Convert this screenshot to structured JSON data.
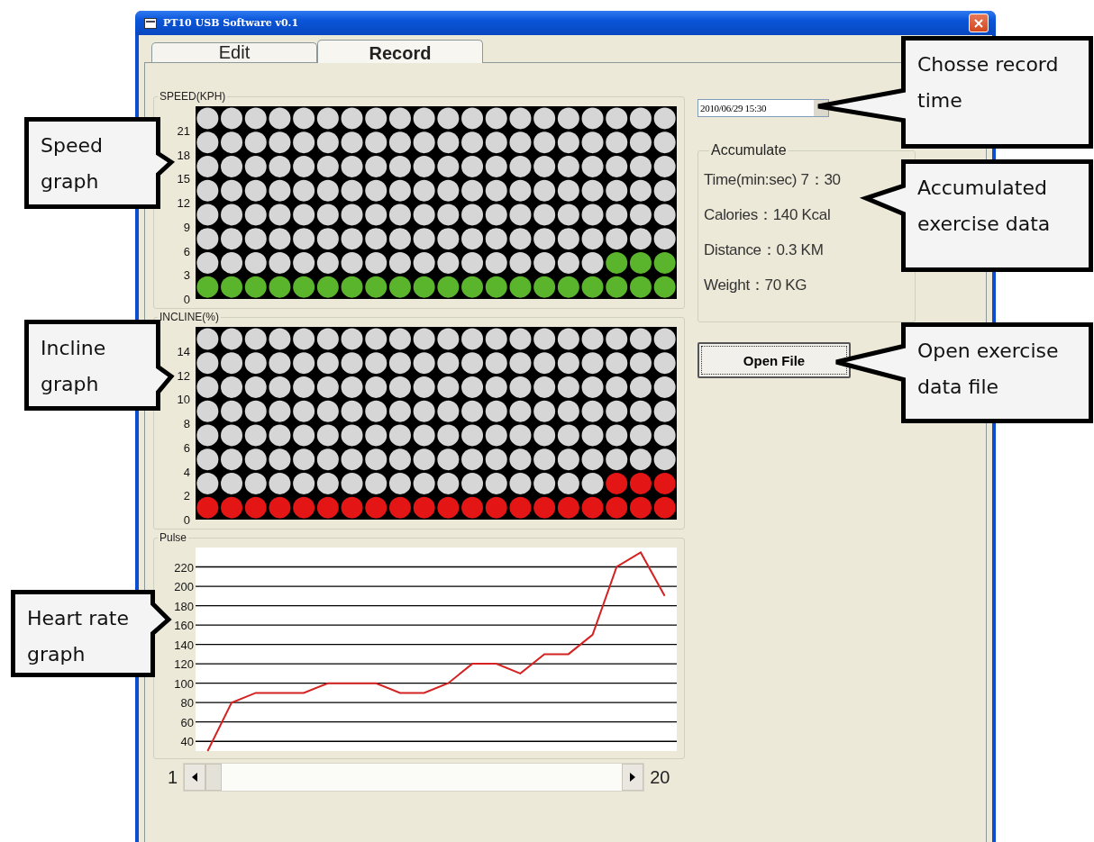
{
  "window": {
    "title": "PT10 USB Software v0.1"
  },
  "tabs": [
    {
      "label": "Edit",
      "selected": false
    },
    {
      "label": "Record",
      "selected": true
    }
  ],
  "speed_panel": {
    "title": "SPEED(KPH)",
    "color": "#5bb52c",
    "axis_labels": [
      "21",
      "18",
      "15",
      "12",
      "9",
      "6",
      "3",
      "0"
    ],
    "columns": [
      {
        "level": 0.125
      },
      {
        "level": 0.125
      },
      {
        "level": 0.125
      },
      {
        "level": 0.125
      },
      {
        "level": 0.125
      },
      {
        "level": 0.125
      },
      {
        "level": 0.125
      },
      {
        "level": 0.125
      },
      {
        "level": 0.125
      },
      {
        "level": 0.125
      },
      {
        "level": 0.125
      },
      {
        "level": 0.125
      },
      {
        "level": 0.125
      },
      {
        "level": 0.125
      },
      {
        "level": 0.125
      },
      {
        "level": 0.125
      },
      {
        "level": 0.125
      },
      {
        "level": 0.25
      },
      {
        "level": 0.25
      },
      {
        "level": 0.25
      }
    ]
  },
  "incline_panel": {
    "title": "INCLINE(%)",
    "color": "#e31515",
    "axis_labels": [
      "14",
      "12",
      "10",
      "8",
      "6",
      "4",
      "2",
      "0"
    ],
    "columns": [
      {
        "level": 0.125
      },
      {
        "level": 0.125
      },
      {
        "level": 0.125
      },
      {
        "level": 0.125
      },
      {
        "level": 0.125
      },
      {
        "level": 0.125
      },
      {
        "level": 0.125
      },
      {
        "level": 0.125
      },
      {
        "level": 0.125
      },
      {
        "level": 0.125
      },
      {
        "level": 0.125
      },
      {
        "level": 0.125
      },
      {
        "level": 0.125
      },
      {
        "level": 0.125
      },
      {
        "level": 0.125
      },
      {
        "level": 0.125
      },
      {
        "level": 0.125
      },
      {
        "level": 0.25
      },
      {
        "level": 0.25
      },
      {
        "level": 0.25
      }
    ]
  },
  "pulse_panel": {
    "title": "Pulse",
    "chart_data": {
      "type": "line",
      "grid": true,
      "ylim": [
        30,
        240
      ],
      "yticks": [
        40,
        60,
        80,
        100,
        120,
        140,
        160,
        180,
        200,
        220
      ],
      "series": [
        {
          "color": "#d42222",
          "values": [
            30,
            80,
            90,
            90,
            90,
            100,
            100,
            100,
            90,
            90,
            100,
            120,
            120,
            110,
            130,
            130,
            150,
            220,
            235,
            190
          ]
        }
      ]
    }
  },
  "scrollbar": {
    "min_label": "1",
    "max_label": "20"
  },
  "record_time": {
    "value": "2010/06/29 15:30"
  },
  "accumulate": {
    "title": "Accumulate",
    "lines": [
      "Time(min:sec) 7：30",
      "Calories：140 Kcal",
      "Distance：0.3 KM",
      "Weight：70 KG"
    ]
  },
  "open_file_button": {
    "label": "Open File"
  },
  "callouts": [
    {
      "text": "Speed graph"
    },
    {
      "text": "Incline graph"
    },
    {
      "text": "Heart rate graph"
    },
    {
      "text": "Chosse record time"
    },
    {
      "text": "Accumulated exercise data"
    },
    {
      "text": "Open exercise data file"
    }
  ]
}
